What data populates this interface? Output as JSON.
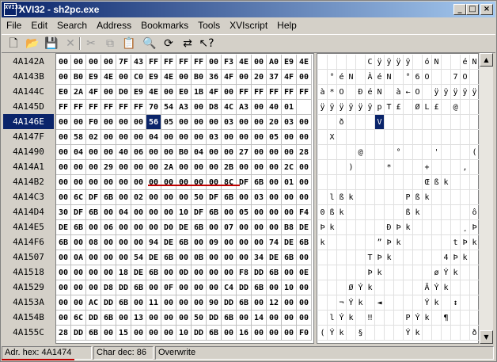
{
  "window": {
    "title": "XVI32 - sh2pc.exe",
    "icon_text": "XVI32",
    "minimize": "_",
    "maximize": "□",
    "close": "×"
  },
  "menu": [
    "File",
    "Edit",
    "Search",
    "Address",
    "Bookmarks",
    "Tools",
    "XVIscript",
    "Help"
  ],
  "toolbar": [
    {
      "name": "new-file-icon",
      "glyph": "🗋",
      "enabled": true
    },
    {
      "name": "open-file-icon",
      "glyph": "📂",
      "enabled": true
    },
    {
      "name": "save-icon",
      "glyph": "💾",
      "enabled": true
    },
    {
      "name": "delete-icon",
      "glyph": "✕",
      "enabled": false
    },
    {
      "name": "cut-icon",
      "glyph": "✂",
      "enabled": false
    },
    {
      "name": "copy-icon",
      "glyph": "⧉",
      "enabled": false
    },
    {
      "name": "paste-icon",
      "glyph": "📋",
      "enabled": false
    },
    {
      "name": "find-icon",
      "glyph": "🔍",
      "enabled": true
    },
    {
      "name": "find-next-icon",
      "glyph": "⟳",
      "enabled": true
    },
    {
      "name": "goto-icon",
      "glyph": "⇄",
      "enabled": true
    },
    {
      "name": "context-help-icon",
      "glyph": "↖?",
      "enabled": true
    }
  ],
  "rows": [
    {
      "addr": "4A142A",
      "hex": [
        "00",
        "00",
        "00",
        "00",
        "7F",
        "43",
        "FF",
        "FF",
        "FF",
        "FF",
        "00",
        "F3",
        "4E",
        "00",
        "A0",
        "E9",
        "4E"
      ],
      "text": [
        "",
        "",
        "",
        "",
        "",
        "C",
        "ÿ",
        "ÿ",
        "ÿ",
        "ÿ",
        "",
        "ó",
        "N",
        "",
        " ",
        "é",
        "N"
      ]
    },
    {
      "addr": "4A143B",
      "hex": [
        "00",
        "B0",
        "E9",
        "4E",
        "00",
        "C0",
        "E9",
        "4E",
        "00",
        "B0",
        "36",
        "4F",
        "00",
        "20",
        "37",
        "4F",
        "00"
      ],
      "text": [
        "",
        "°",
        "é",
        "N",
        "",
        "À",
        "é",
        "N",
        "",
        "°",
        "6",
        "O",
        "",
        " ",
        "7",
        "O",
        ""
      ]
    },
    {
      "addr": "4A144C",
      "hex": [
        "E0",
        "2A",
        "4F",
        "00",
        "D0",
        "E9",
        "4E",
        "00",
        "E0",
        "1B",
        "4F",
        "00",
        "FF",
        "FF",
        "FF",
        "FF",
        "FF"
      ],
      "text": [
        "à",
        "*",
        "O",
        "",
        "Ð",
        "é",
        "N",
        "",
        "à",
        "←",
        "O",
        "",
        "ÿ",
        "ÿ",
        "ÿ",
        "ÿ",
        "ÿ"
      ]
    },
    {
      "addr": "4A145D",
      "hex": [
        "FF",
        "FF",
        "FF",
        "FF",
        "FF",
        "FF",
        "70",
        "54",
        "A3",
        "00",
        "D8",
        "4C",
        "A3",
        "00",
        "40",
        "01",
        ""
      ],
      "text": [
        "ÿ",
        "ÿ",
        "ÿ",
        "ÿ",
        "ÿ",
        "ÿ",
        "p",
        "T",
        "£",
        "",
        "Ø",
        "L",
        "£",
        "",
        "@",
        "",
        ""
      ]
    },
    {
      "addr": "4A146E",
      "hex": [
        "00",
        "00",
        "F0",
        "00",
        "00",
        "00",
        "56",
        "05",
        "00",
        "00",
        "00",
        "03",
        "00",
        "00",
        "20",
        "03",
        "00"
      ],
      "text": [
        "",
        "",
        "ð",
        "",
        "",
        "",
        "V",
        "",
        "",
        "",
        "",
        "",
        "",
        "",
        "",
        "",
        ""
      ]
    },
    {
      "addr": "4A147F",
      "hex": [
        "00",
        "58",
        "02",
        "00",
        "00",
        "00",
        "04",
        "00",
        "00",
        "00",
        "03",
        "00",
        "00",
        "00",
        "05",
        "00",
        "00"
      ],
      "text": [
        "",
        "X",
        "",
        "",
        "",
        "",
        "",
        "",
        "",
        "",
        "",
        "",
        "",
        "",
        "",
        "",
        ""
      ]
    },
    {
      "addr": "4A1490",
      "hex": [
        "00",
        "04",
        "00",
        "00",
        "40",
        "06",
        "00",
        "00",
        "B0",
        "04",
        "00",
        "00",
        "27",
        "00",
        "00",
        "00",
        "28"
      ],
      "text": [
        "",
        "",
        "",
        "",
        "@",
        "",
        "",
        "",
        "°",
        "",
        "",
        "",
        "'",
        "",
        "",
        "",
        "("
      ]
    },
    {
      "addr": "4A14A1",
      "hex": [
        "00",
        "00",
        "00",
        "29",
        "00",
        "00",
        "00",
        "2A",
        "00",
        "00",
        "00",
        "2B",
        "00",
        "00",
        "00",
        "2C",
        "00"
      ],
      "text": [
        "",
        "",
        "",
        ")",
        "",
        "",
        "",
        "*",
        "",
        "",
        "",
        "+",
        "",
        "",
        "",
        ",",
        ""
      ]
    },
    {
      "addr": "4A14B2",
      "hex": [
        "00",
        "00",
        "00",
        "00",
        "00",
        "00",
        "00",
        "00",
        "00",
        "00",
        "00",
        "8C",
        "DF",
        "6B",
        "00",
        "01",
        "00"
      ],
      "text": [
        "",
        "",
        "",
        "",
        "",
        "",
        "",
        "",
        "",
        "",
        "",
        "Œ",
        "ß",
        "k",
        "",
        "",
        ""
      ]
    },
    {
      "addr": "4A14C3",
      "hex": [
        "00",
        "6C",
        "DF",
        "6B",
        "00",
        "02",
        "00",
        "00",
        "00",
        "50",
        "DF",
        "6B",
        "00",
        "03",
        "00",
        "00",
        "00"
      ],
      "text": [
        "",
        "l",
        "ß",
        "k",
        "",
        "",
        "",
        "",
        "",
        "P",
        "ß",
        "k",
        "",
        "",
        "",
        "",
        ""
      ]
    },
    {
      "addr": "4A14D4",
      "hex": [
        "30",
        "DF",
        "6B",
        "00",
        "04",
        "00",
        "00",
        "00",
        "10",
        "DF",
        "6B",
        "00",
        "05",
        "00",
        "00",
        "00",
        "F4"
      ],
      "text": [
        "0",
        "ß",
        "k",
        "",
        "",
        "",
        "",
        "",
        "",
        "ß",
        "k",
        "",
        "",
        "",
        "",
        "",
        "ô"
      ]
    },
    {
      "addr": "4A14E5",
      "hex": [
        "DE",
        "6B",
        "00",
        "06",
        "00",
        "00",
        "00",
        "D0",
        "DE",
        "6B",
        "00",
        "07",
        "00",
        "00",
        "00",
        "B8",
        "DE"
      ],
      "text": [
        "Þ",
        "k",
        "",
        "",
        "",
        "",
        "",
        "Ð",
        "Þ",
        "k",
        "",
        "",
        "",
        "",
        "",
        "¸",
        "Þ"
      ]
    },
    {
      "addr": "4A14F6",
      "hex": [
        "6B",
        "00",
        "08",
        "00",
        "00",
        "00",
        "94",
        "DE",
        "6B",
        "00",
        "09",
        "00",
        "00",
        "00",
        "74",
        "DE",
        "6B"
      ],
      "text": [
        "k",
        "",
        "",
        "",
        "",
        "",
        "”",
        "Þ",
        "k",
        "",
        "",
        "",
        "",
        "",
        "t",
        "Þ",
        "k"
      ]
    },
    {
      "addr": "4A1507",
      "hex": [
        "00",
        "0A",
        "00",
        "00",
        "00",
        "54",
        "DE",
        "6B",
        "00",
        "0B",
        "00",
        "00",
        "00",
        "34",
        "DE",
        "6B",
        "00"
      ],
      "text": [
        "",
        "",
        "",
        "",
        "",
        "T",
        "Þ",
        "k",
        "",
        "",
        "",
        "",
        "",
        "4",
        "Þ",
        "k",
        ""
      ]
    },
    {
      "addr": "4A1518",
      "hex": [
        "00",
        "00",
        "00",
        "00",
        "18",
        "DE",
        "6B",
        "00",
        "0D",
        "00",
        "00",
        "00",
        "F8",
        "DD",
        "6B",
        "00",
        "0E"
      ],
      "text": [
        "",
        "",
        "",
        "",
        "",
        "Þ",
        "k",
        "",
        "",
        "",
        "",
        "",
        "ø",
        "Ý",
        "k",
        "",
        ""
      ]
    },
    {
      "addr": "4A1529",
      "hex": [
        "00",
        "00",
        "00",
        "D8",
        "DD",
        "6B",
        "00",
        "0F",
        "00",
        "00",
        "00",
        "C4",
        "DD",
        "6B",
        "00",
        "10",
        "00"
      ],
      "text": [
        "",
        "",
        "",
        "Ø",
        "Ý",
        "k",
        "",
        "",
        "",
        "",
        "",
        "Ä",
        "Ý",
        "k",
        "",
        "",
        ""
      ]
    },
    {
      "addr": "4A153A",
      "hex": [
        "00",
        "00",
        "AC",
        "DD",
        "6B",
        "00",
        "11",
        "00",
        "00",
        "00",
        "90",
        "DD",
        "6B",
        "00",
        "12",
        "00",
        "00"
      ],
      "text": [
        "",
        "",
        "¬",
        "Ý",
        "k",
        "",
        "◄",
        "",
        "",
        "",
        "",
        "Ý",
        "k",
        "",
        "↕",
        "",
        ""
      ]
    },
    {
      "addr": "4A154B",
      "hex": [
        "00",
        "6C",
        "DD",
        "6B",
        "00",
        "13",
        "00",
        "00",
        "00",
        "50",
        "DD",
        "6B",
        "00",
        "14",
        "00",
        "00",
        "00"
      ],
      "text": [
        "",
        "l",
        "Ý",
        "k",
        "",
        "‼",
        "",
        "",
        "",
        "P",
        "Ý",
        "k",
        "",
        "¶",
        "",
        "",
        ""
      ]
    },
    {
      "addr": "4A155C",
      "hex": [
        "28",
        "DD",
        "6B",
        "00",
        "15",
        "00",
        "00",
        "00",
        "10",
        "DD",
        "6B",
        "00",
        "16",
        "00",
        "00",
        "00",
        "F0"
      ],
      "text": [
        "(",
        "Ý",
        "k",
        "",
        "§",
        "",
        "",
        "",
        "",
        "Ý",
        "k",
        "",
        "",
        "",
        "",
        "",
        "ð"
      ]
    }
  ],
  "selected_row": 4,
  "cursor_col": 6,
  "status": {
    "address": "Adr. hex: 4A1474",
    "char": "Char dec: 86",
    "mode": "Overwrite"
  },
  "colors": {
    "titlebar": "#0a246a",
    "selection": "#0a246a",
    "annotation": "#c00000"
  }
}
